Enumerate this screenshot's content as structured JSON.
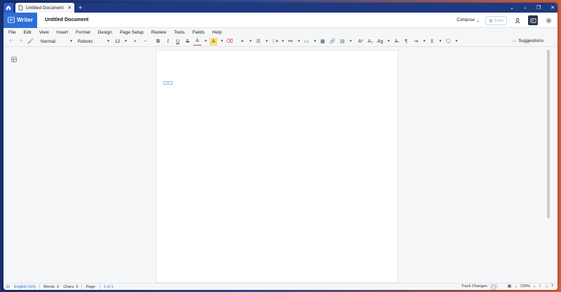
{
  "window": {
    "tab_title": "Untitled Document",
    "new_tab_symbol": "+",
    "controls": [
      "⌄",
      "–",
      "❐",
      "✕"
    ]
  },
  "header": {
    "brand_name": "Writer",
    "doc_title": "Untitled Document",
    "compose_label": "Compose",
    "save_label": "Save"
  },
  "menu": [
    "File",
    "Edit",
    "View",
    "Insert",
    "Format",
    "Design",
    "Page Setup",
    "Review",
    "Tools",
    "Fields",
    "Help"
  ],
  "toolbar": {
    "style_value": "Normal",
    "font_value": "Roboto",
    "size_value": "12",
    "bold": "B",
    "italic": "I",
    "underline": "U",
    "strike": "S",
    "font_color": "A",
    "highlight": "A",
    "superscript": "A²",
    "subscript": "A₂",
    "case": "Ag",
    "suggestions_label": "Suggestions"
  },
  "status": {
    "language": "English (US)",
    "words_label": "Words:",
    "words_value": "0",
    "chars_label": "Chars:",
    "chars_value": "0",
    "page_label": "Page:",
    "page_value": "1 of 1",
    "track_changes_label": "Track Changes",
    "zoom": "100%"
  },
  "colors": {
    "brand": "#2d6fd8",
    "titlebar": "#1f3a80",
    "font_color_underline": "#e53935",
    "highlight_color": "#f9c300"
  }
}
